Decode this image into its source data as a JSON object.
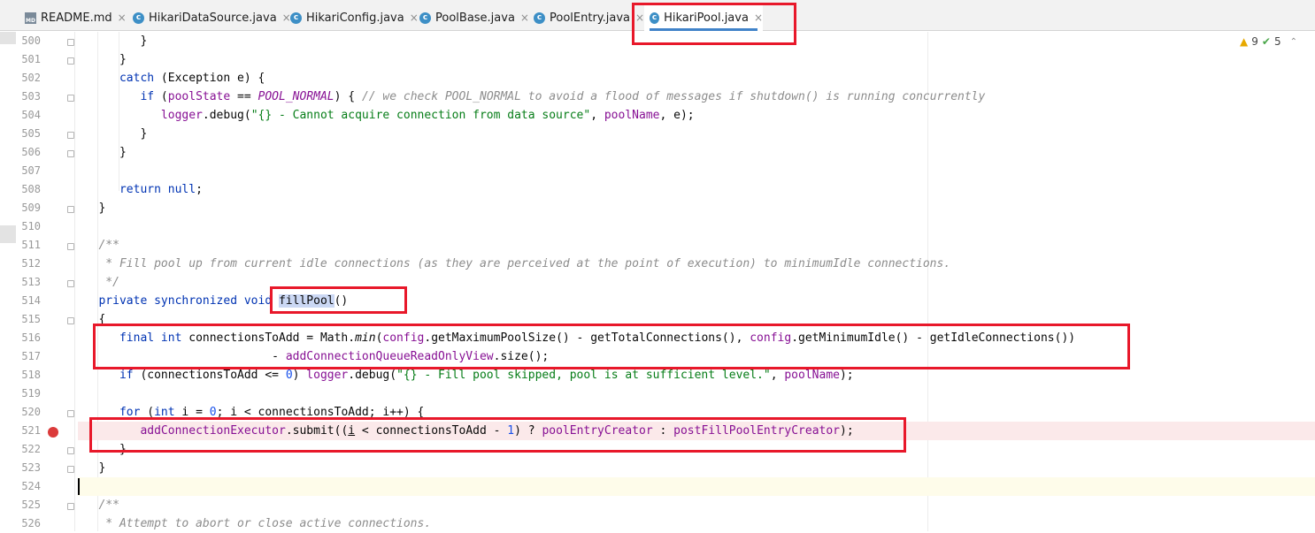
{
  "tabs": [
    {
      "label": "README.md",
      "icon": "markdown-file-icon"
    },
    {
      "label": "HikariDataSource.java",
      "icon": "java-class-icon"
    },
    {
      "label": "HikariConfig.java",
      "icon": "java-class-icon"
    },
    {
      "label": "PoolBase.java",
      "icon": "java-class-icon"
    },
    {
      "label": "PoolEntry.java",
      "icon": "java-class-icon"
    },
    {
      "label": "HikariPool.java",
      "icon": "java-class-icon",
      "active": true
    }
  ],
  "inspections": {
    "warnings": "9",
    "weak_warnings": "5"
  },
  "colors": {
    "accent": "#4083c9",
    "highlight_box": "#e8182a",
    "breakpoint": "#db3b3b"
  },
  "line_numbers": [
    "500",
    "501",
    "502",
    "503",
    "504",
    "505",
    "506",
    "507",
    "508",
    "509",
    "510",
    "511",
    "512",
    "513",
    "514",
    "515",
    "516",
    "517",
    "518",
    "519",
    "520",
    "521",
    "522",
    "523",
    "524",
    "525",
    "526"
  ],
  "code": {
    "l500": "         }",
    "l501": "      }",
    "l502_kw": "catch",
    "l502_rest": " (Exception e) {",
    "l503_kw": "if",
    "l503_a": " (",
    "l503_fld": "poolState",
    "l503_b": " == ",
    "l503_cst": "POOL_NORMAL",
    "l503_c": ") { ",
    "l503_cm": "// we check POOL_NORMAL to avoid a flood of messages if shutdown() is running concurrently",
    "l504_fld": "logger",
    "l504_a": ".debug(",
    "l504_str": "\"{} - Cannot acquire connection from data source\"",
    "l504_b": ", ",
    "l504_fld2": "poolName",
    "l504_c": ", e);",
    "l505": "         }",
    "l506": "      }",
    "l508_kw": "return null",
    "l508_rest": ";",
    "l509": "   }",
    "l511": "   /**",
    "l512": "    * Fill pool up from current idle connections (as they are perceived at the point of execution) to minimumIdle connections.",
    "l513": "    */",
    "l514_kw": "private synchronized void",
    "l514_name": "fillPool",
    "l514_rest": "()",
    "l515": "   {",
    "l516_kw": "final int",
    "l516_a": " connectionsToAdd = Math.",
    "l516_sm": "min",
    "l516_b": "(",
    "l516_fld": "config",
    "l516_c": ".getMaximumPoolSize() - getTotalConnections(), ",
    "l516_fld2": "config",
    "l516_d": ".getMinimumIdle() - getIdleConnections())",
    "l517_a": "                            - ",
    "l517_fld": "addConnectionQueueReadOnlyView",
    "l517_b": ".size();",
    "l518_kw": "if",
    "l518_a": " (connectionsToAdd <= ",
    "l518_num": "0",
    "l518_b": ") ",
    "l518_fld": "logger",
    "l518_c": ".debug(",
    "l518_str": "\"{} - Fill pool skipped, pool is at sufficient level.\"",
    "l518_d": ", ",
    "l518_fld2": "poolName",
    "l518_e": ");",
    "l520_kw": "for",
    "l520_a": " (",
    "l520_kw2": "int",
    "l520_b": " i = ",
    "l520_num": "0",
    "l520_c": "; i < connectionsToAdd; i++) {",
    "l521_fld": "addConnectionExecutor",
    "l521_a": ".submit((",
    "l521_ul": "i",
    "l521_b": " < connectionsToAdd - ",
    "l521_num": "1",
    "l521_c": ") ? ",
    "l521_fld2": "poolEntryCreator",
    "l521_d": " : ",
    "l521_fld3": "postFillPoolEntryCreator",
    "l521_e": ");",
    "l522": "      }",
    "l523": "   }",
    "l525": "   /**",
    "l526": "    * Attempt to abort or close active connections."
  }
}
